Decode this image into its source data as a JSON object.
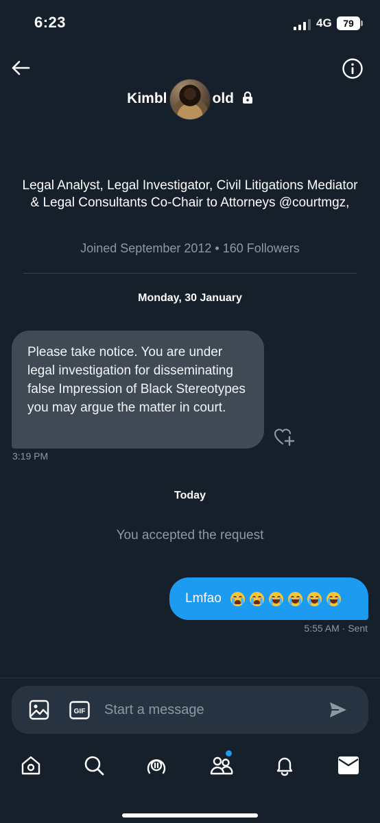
{
  "status_bar": {
    "time": "6:23",
    "network": "4G",
    "battery": "79"
  },
  "header": {
    "name_left": "Kimbl",
    "name_right": "old",
    "icons": {
      "back": "arrow-left-icon",
      "info": "info-circle-icon",
      "lock": "lock-icon"
    }
  },
  "profile": {
    "bio": "Legal Analyst, Legal Investigator, Civil Litigations Mediator & Legal Consultants Co-Chair to Attorneys @courtmgz,",
    "joined": "Joined September 2012 • 160 Followers"
  },
  "conversation": {
    "date_separator": "Monday, 30 January",
    "incoming": {
      "text": "Please take notice. You are under legal investigation for disseminating false Impression of Black Stereotypes you may argue the matter in court.",
      "time": "3:19 PM"
    },
    "today_separator": "Today",
    "accepted_notice": "You accepted the request",
    "outgoing": {
      "text": "Lmfao",
      "emojis": [
        "loudly-crying-face",
        "loudly-crying-face",
        "face-with-tears-of-joy",
        "face-with-tears-of-joy",
        "face-with-tears-of-joy",
        "face-with-tears-of-joy"
      ],
      "time": "5:55 AM · Sent"
    }
  },
  "composer": {
    "placeholder": "Start a message",
    "gif_label": "GIF",
    "icons": {
      "image": "image-icon",
      "gif": "gif-icon",
      "send": "send-icon"
    }
  },
  "bottom_nav": [
    {
      "name": "home",
      "icon": "home-icon"
    },
    {
      "name": "search",
      "icon": "search-icon"
    },
    {
      "name": "spaces",
      "icon": "spaces-icon"
    },
    {
      "name": "communities",
      "icon": "communities-icon",
      "badge": true
    },
    {
      "name": "notifications",
      "icon": "bell-icon"
    },
    {
      "name": "messages",
      "icon": "mail-icon"
    }
  ],
  "colors": {
    "background": "#15202b",
    "incoming_bubble": "#3f4a55",
    "outgoing_bubble": "#1d9bf0",
    "secondary_text": "#8b98a5",
    "accent": "#1d9bf0"
  }
}
